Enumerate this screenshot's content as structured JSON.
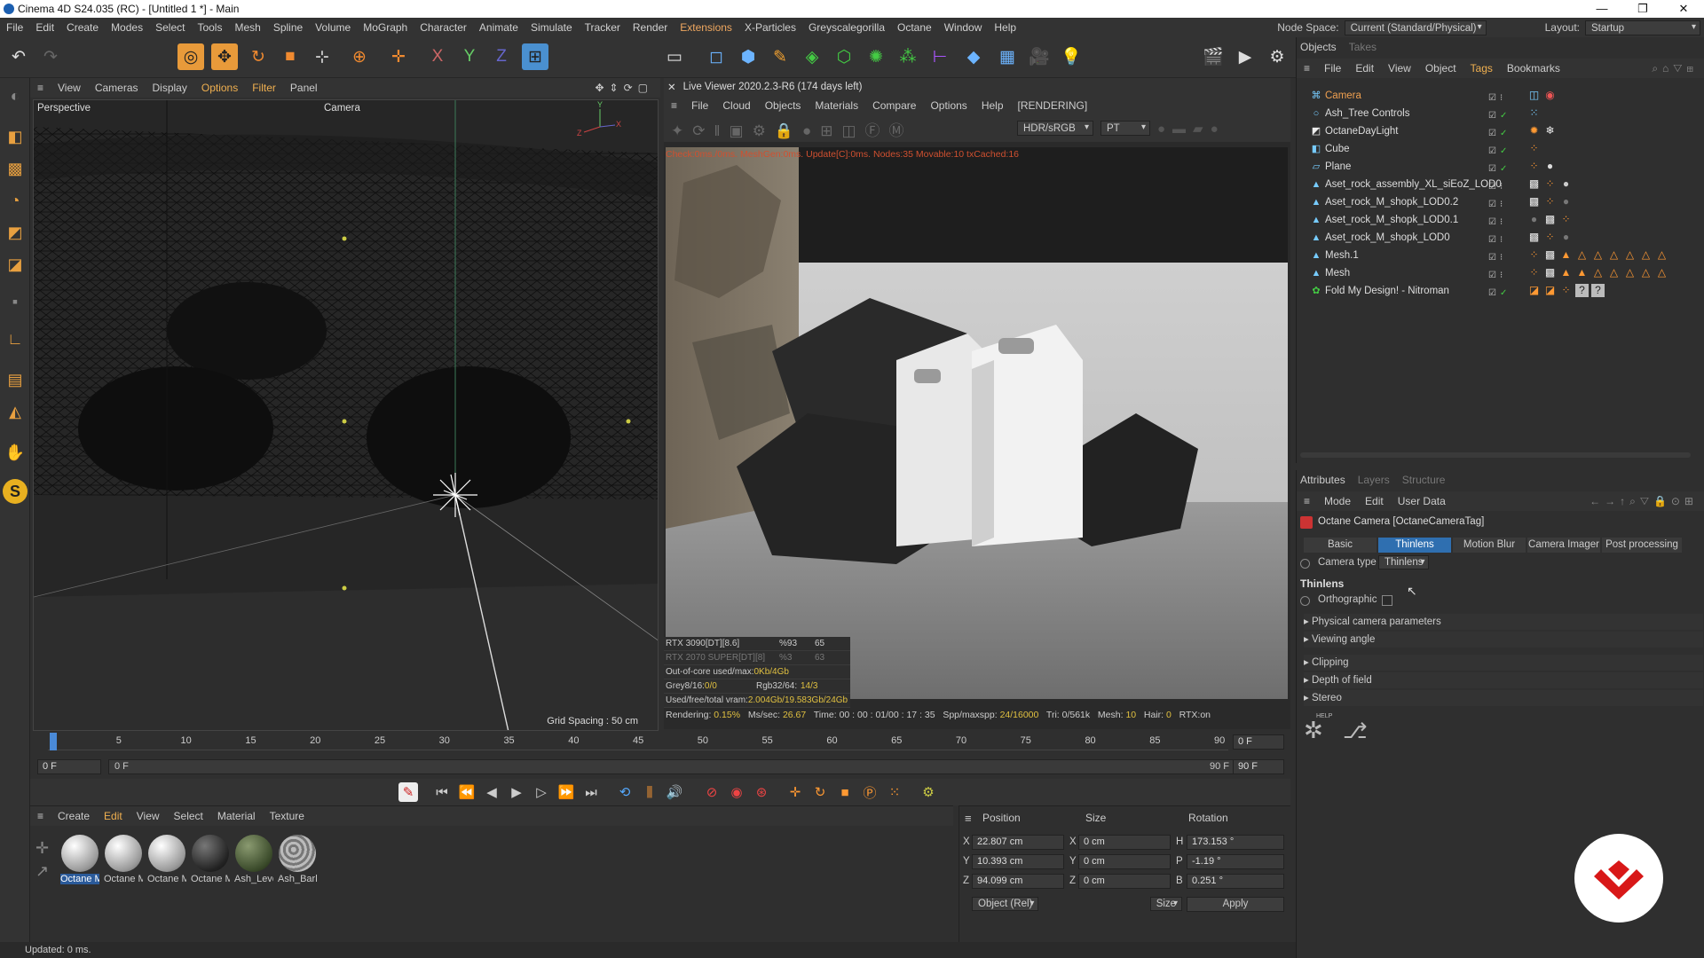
{
  "window": {
    "title": "Cinema 4D S24.035 (RC) - [Untitled 1 *] - Main",
    "controls": [
      "—",
      "❐",
      "✕"
    ]
  },
  "menu": [
    "File",
    "Edit",
    "Create",
    "Modes",
    "Select",
    "Tools",
    "Mesh",
    "Spline",
    "Volume",
    "MoGraph",
    "Character",
    "Animate",
    "Simulate",
    "Tracker",
    "Render",
    "Extensions",
    "X-Particles",
    "Greyscalegorilla",
    "Octane",
    "Window",
    "Help"
  ],
  "nodespace": {
    "label": "Node Space:",
    "value": "Current (Standard/Physical)",
    "layout_label": "Layout:",
    "layout_value": "Startup"
  },
  "viewport": {
    "menu": [
      "View",
      "Cameras",
      "Display",
      "Options",
      "Filter",
      "Panel"
    ],
    "name": "Perspective",
    "camera": "Camera",
    "grid": "Grid Spacing : 50 cm"
  },
  "liveviewer": {
    "title": "Live Viewer 2020.2.3-R6 (174 days left)",
    "menu": [
      "File",
      "Cloud",
      "Objects",
      "Materials",
      "Compare",
      "Options",
      "Help"
    ],
    "status_tag": "[RENDERING]",
    "color_mode": "HDR/sRGB",
    "kernel": "PT",
    "status": "Check:0ms./0ms. MeshGen:0ms. Update[C]:0ms. Nodes:35 Movable:10 txCached:16",
    "stats": {
      "gpu1": "RTX 3090[DT][8.6]",
      "gpu1_pct": "%93",
      "gpu1_temp": "65",
      "gpu2": "RTX 2070 SUPER[DT][8]",
      "gpu2_pct": "%3",
      "gpu2_temp": "63",
      "ooc_label": "Out-of-core used/max:",
      "ooc": "0Kb/4Gb",
      "grey_label": "Grey8/16:",
      "grey": "0/0",
      "rgb_label": "Rgb32/64:",
      "rgb": "14/3",
      "vram_label": "Used/free/total vram:",
      "vram": "2.004Gb/19.583Gb/24Gb"
    },
    "bar": {
      "rendering_label": "Rendering:",
      "rendering": "0.15%",
      "mssec_label": "Ms/sec:",
      "mssec": "26.67",
      "time_label": "Time:",
      "time": "00 : 00 : 01/00 : 17 : 35",
      "spp_label": "Spp/maxspp:",
      "spp": "24/16000",
      "tri_label": "Tri:",
      "tri": "0/561k",
      "mesh_label": "Mesh:",
      "mesh": "10",
      "hair_label": "Hair:",
      "hair": "0",
      "rtx": "RTX:on"
    }
  },
  "timeline": {
    "ticks": [
      "0",
      "5",
      "10",
      "15",
      "20",
      "25",
      "30",
      "35",
      "40",
      "45",
      "50",
      "55",
      "60",
      "65",
      "70",
      "75",
      "80",
      "85",
      "90"
    ],
    "current": "0 F",
    "start": "0 F",
    "start2": "0 F",
    "end": "90 F",
    "end2": "90 F",
    "end3": "90 F"
  },
  "materials": {
    "menu": [
      "Create",
      "Edit",
      "View",
      "Select",
      "Material",
      "Texture"
    ],
    "items": [
      "Octane M",
      "Octane M",
      "Octane M",
      "Octane M",
      "Ash_Leve",
      "Ash_Bark"
    ]
  },
  "coords": {
    "headers": [
      "Position",
      "Size",
      "Rotation"
    ],
    "px": "22.807 cm",
    "py": "10.393 cm",
    "pz": "94.099 cm",
    "sx": "0 cm",
    "sy": "0 cm",
    "sz": "0 cm",
    "rh": "173.153 °",
    "rp": "-1.19 °",
    "rb": "0.251 °",
    "mode": "Object (Rel)",
    "size_mode": "Size",
    "apply": "Apply",
    "axis": [
      "X",
      "Y",
      "Z",
      "X",
      "Y",
      "Z",
      "H",
      "P",
      "B"
    ]
  },
  "status": "Updated: 0 ms.",
  "objects": {
    "tabs": [
      "Objects",
      "Takes"
    ],
    "menu": [
      "File",
      "Edit",
      "View",
      "Object",
      "Tags",
      "Bookmarks"
    ],
    "items": [
      "Camera",
      "Ash_Tree Controls",
      "OctaneDayLight",
      "Cube",
      "Plane",
      "Aset_rock_assembly_XL_siEoZ_LOD0",
      "Aset_rock_M_shopk_LOD0.2",
      "Aset_rock_M_shopk_LOD0.1",
      "Aset_rock_M_shopk_LOD0",
      "Mesh.1",
      "Mesh",
      "Fold My Design! - Nitroman"
    ]
  },
  "attributes": {
    "tabs": [
      "Attributes",
      "Layers",
      "Structure"
    ],
    "menu": [
      "Mode",
      "Edit",
      "User Data"
    ],
    "object": "Octane Camera [OctaneCameraTag]",
    "subtabs": [
      "Basic",
      "Thinlens",
      "Motion Blur",
      "Camera Imager",
      "Post processing"
    ],
    "camera_type_label": "Camera type",
    "camera_type": "Thinlens",
    "section": "Thinlens",
    "ortho": "Orthographic",
    "groups": [
      "Physical camera parameters",
      "Viewing angle",
      "Clipping",
      "Depth of field",
      "Stereo"
    ],
    "help": "HELP"
  }
}
